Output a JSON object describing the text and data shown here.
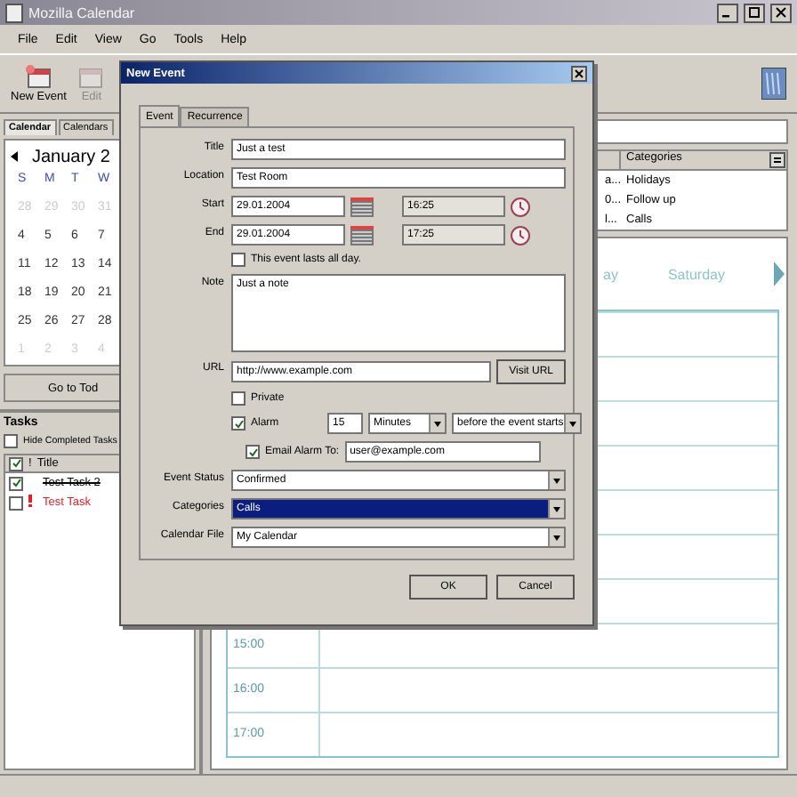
{
  "window": {
    "title": "Mozilla Calendar"
  },
  "menu": [
    "File",
    "Edit",
    "View",
    "Go",
    "Tools",
    "Help"
  ],
  "toolbar": [
    {
      "label": "New Event",
      "disabled": false
    },
    {
      "label": "Edit",
      "disabled": true
    }
  ],
  "sidebar_tabs": [
    {
      "label": "Calendar",
      "selected": true
    },
    {
      "label": "Calendars",
      "selected": false
    }
  ],
  "mini_calendar": {
    "month": "January 2",
    "weekdays": [
      "S",
      "M",
      "T",
      "W"
    ],
    "weeks": [
      [
        {
          "day": "28",
          "other_month": true
        },
        {
          "day": "29",
          "other_month": true
        },
        {
          "day": "30",
          "other_month": true
        },
        {
          "day": "31",
          "other_month": true
        }
      ],
      [
        {
          "day": "4",
          "other_month": false
        },
        {
          "day": "5",
          "other_month": false
        },
        {
          "day": "6",
          "other_month": false
        },
        {
          "day": "7",
          "other_month": false
        }
      ],
      [
        {
          "day": "11",
          "other_month": false
        },
        {
          "day": "12",
          "other_month": false
        },
        {
          "day": "13",
          "other_month": false
        },
        {
          "day": "14",
          "other_month": false
        }
      ],
      [
        {
          "day": "18",
          "other_month": false
        },
        {
          "day": "19",
          "other_month": false
        },
        {
          "day": "20",
          "other_month": false
        },
        {
          "day": "21",
          "other_month": false
        }
      ],
      [
        {
          "day": "25",
          "other_month": false
        },
        {
          "day": "26",
          "other_month": false
        },
        {
          "day": "27",
          "other_month": false
        },
        {
          "day": "28",
          "other_month": false
        }
      ],
      [
        {
          "day": "1",
          "other_month": true
        },
        {
          "day": "2",
          "other_month": true
        },
        {
          "day": "3",
          "other_month": true
        },
        {
          "day": "4",
          "other_month": true
        }
      ]
    ]
  },
  "go_to_today": "Go to Tod",
  "tasks": {
    "title": "Tasks",
    "hide_completed": {
      "label": "Hide Completed Tasks",
      "checked": false
    },
    "columns": [
      "!",
      "Title"
    ],
    "items": [
      {
        "title": "Test Task 2",
        "completed": true,
        "high_priority": false
      },
      {
        "title": "Test Task",
        "completed": false,
        "high_priority": true
      }
    ]
  },
  "event_list": {
    "columns": [
      "Categories"
    ],
    "rows": [
      {
        "column_1": "a...",
        "categories": "Holidays"
      },
      {
        "column_1": "0...",
        "categories": "Follow up"
      },
      {
        "column_1": "l...",
        "categories": "Calls"
      }
    ]
  },
  "day_view": {
    "days": [
      "ay",
      "Saturday"
    ],
    "hours": [
      "15:00",
      "16:00",
      "17:00"
    ]
  },
  "dialog": {
    "title": "New Event",
    "tabs": [
      {
        "label": "Event",
        "selected": true
      },
      {
        "label": "Recurrence",
        "selected": false
      }
    ],
    "title_label": "Title",
    "title_value": "Just a test",
    "location_label": "Location",
    "location_value": "Test Room",
    "start_label": "Start",
    "start_date": "29.01.2004",
    "start_time": "16:25",
    "end_label": "End",
    "end_date": "29.01.2004",
    "end_time": "17:25",
    "all_day": {
      "label": "This event lasts all day.",
      "checked": false
    },
    "note_label": "Note",
    "note_value": "Just a note",
    "url_label": "URL",
    "url_value": "http://www.example.com",
    "visit_url": "Visit URL",
    "private": {
      "label": "Private",
      "checked": false
    },
    "alarm": {
      "label": "Alarm",
      "checked": true,
      "amount": "15",
      "unit": "Minutes",
      "relation": "before the event starts"
    },
    "email_alarm": {
      "label": "Email Alarm To:",
      "checked": true,
      "address": "user@example.com"
    },
    "status_label": "Event Status",
    "status_value": "Confirmed",
    "categories_label": "Categories",
    "categories_value": "Calls",
    "file_label": "Calendar File",
    "file_value": "My Calendar",
    "buttons": [
      "OK",
      "Cancel"
    ]
  }
}
